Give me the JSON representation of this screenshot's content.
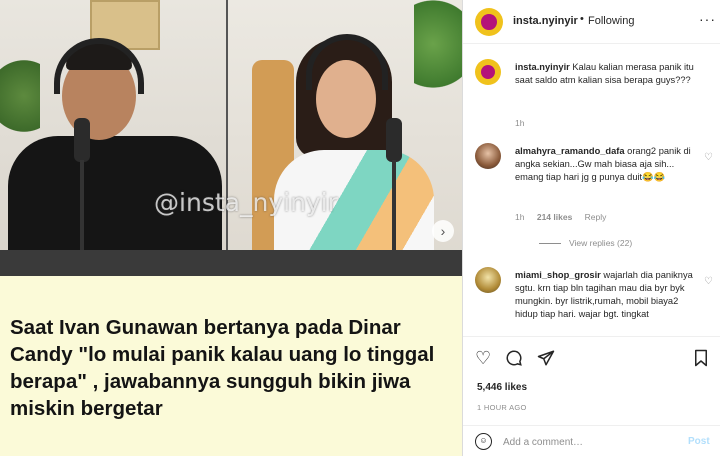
{
  "post": {
    "watermark": "@insta_nyinyir",
    "caption": "Saat Ivan Gunawan bertanya pada Dinar Candy \"lo mulai panik kalau uang lo tinggal berapa\" , jawabannya  sungguh bikin jiwa miskin bergetar"
  },
  "header": {
    "username": "insta.nyinyir",
    "dot": "•",
    "follow_status": "Following",
    "more": "···"
  },
  "comments": [
    {
      "username": "insta.nyinyir",
      "text": "Kalau kalian merasa panik itu saat saldo atm kalian sisa berapa guys???",
      "time": "1h"
    },
    {
      "username": "almahyra_ramando_dafa",
      "text": "orang2 panik di angka sekian...Gw mah biasa aja sih... emang tiap hari jg g punya duit😂😂",
      "time": "1h",
      "likes": "214 likes",
      "reply": "Reply",
      "view_replies": "View replies (22)"
    },
    {
      "username": "miami_shop_grosir",
      "text": "wajarlah dia paniknya sgtu. krn tiap bln tagihan mau dia byr byk mungkin. byr listrik,rumah, mobil biaya2 hidup tiap hari. wajar bgt. tingkat"
    }
  ],
  "actions": {
    "likes": "5,446 likes",
    "time": "1 HOUR AGO",
    "comment_placeholder": "Add a comment…",
    "post_label": "Post",
    "icons": [
      "heart-icon",
      "comment-icon",
      "share-icon",
      "bookmark-icon",
      "emoji-icon"
    ]
  },
  "colors": {
    "caption_bg": "#fbfad8",
    "link_blue_disabled": "#b2dffc",
    "muted_text": "#8e8e8e"
  }
}
